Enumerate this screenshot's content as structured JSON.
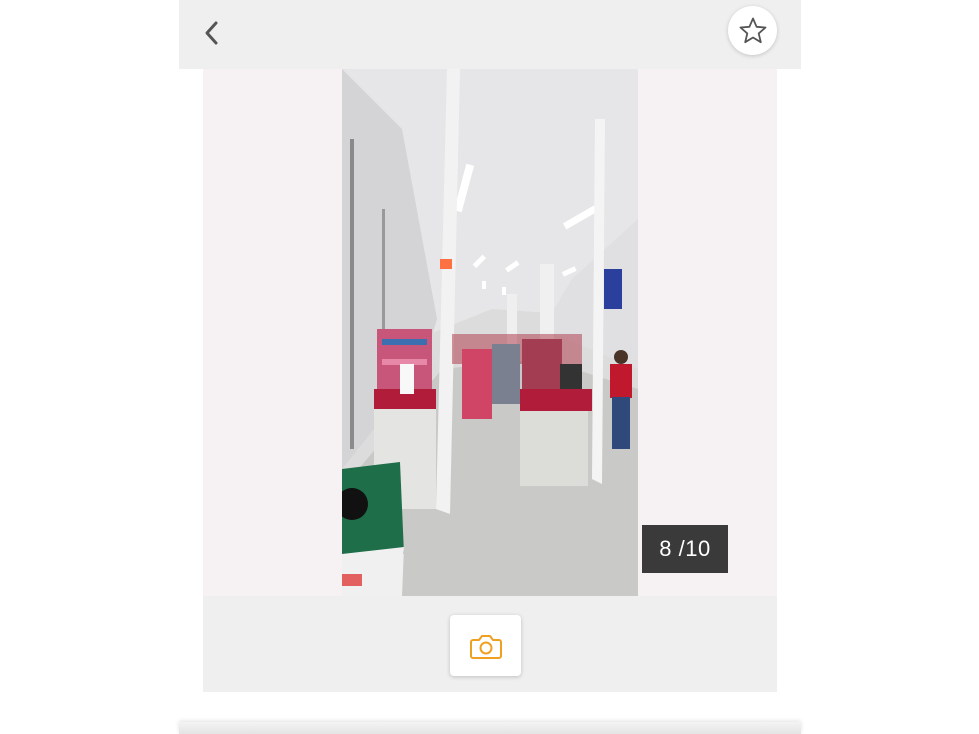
{
  "header": {
    "back_icon": "chevron-left-icon",
    "favorite_icon": "star-outline-icon"
  },
  "gallery": {
    "counter_current": "8",
    "counter_total": "10",
    "counter_text": "8 /10",
    "photo_description_icon": "store-photo"
  },
  "actions": {
    "camera_icon": "camera-icon",
    "camera_color": "#f0a020"
  }
}
